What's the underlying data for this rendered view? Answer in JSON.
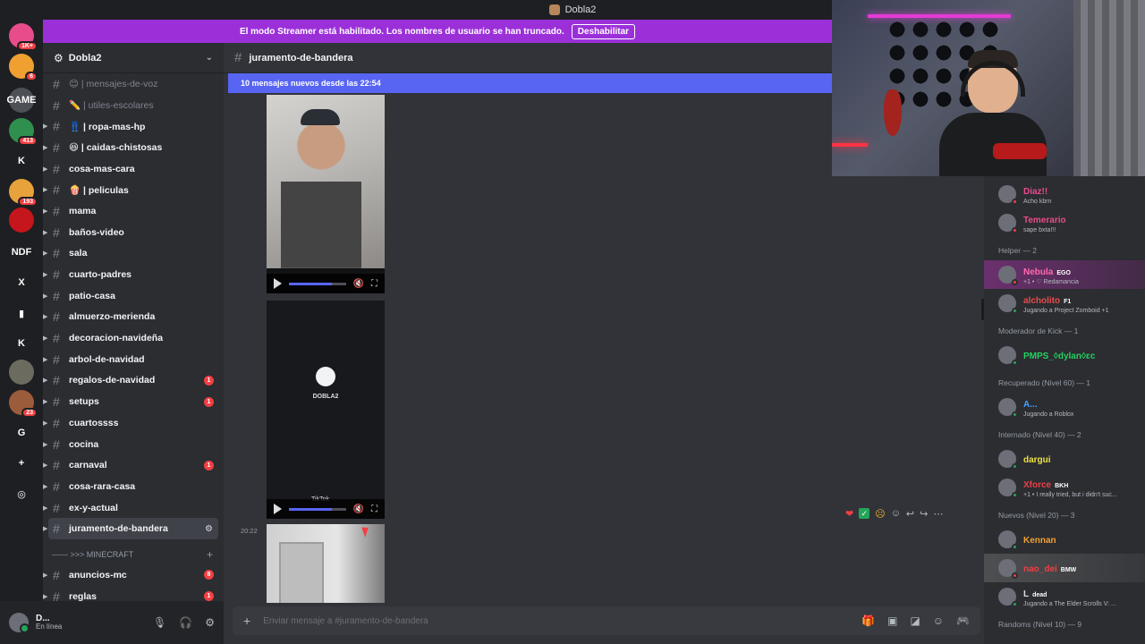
{
  "title_bar": {
    "server_name": "Dobla2"
  },
  "banner": {
    "text": "El modo Streamer está habilitado. Los nombres de usuario se han truncado.",
    "button": "Deshabilitar"
  },
  "rail": {
    "servers": [
      {
        "label": "",
        "badge": "1K+",
        "color": "#e84c8b"
      },
      {
        "label": "",
        "badge": "6",
        "color": "#f0a030"
      },
      {
        "label": "GAME",
        "badge": "",
        "color": "#4e5058"
      },
      {
        "label": "",
        "badge": "413",
        "color": "#2f8f4e"
      },
      {
        "label": "K",
        "badge": "",
        "color": "#1e1f22"
      },
      {
        "label": "",
        "badge": "193",
        "color": "#e8a23c"
      },
      {
        "label": "",
        "badge": "",
        "color": "#c4161c"
      },
      {
        "label": "NDF",
        "badge": "",
        "color": "#1e1f22"
      },
      {
        "label": "X",
        "badge": "",
        "color": "#1e1f22"
      },
      {
        "label": "▮",
        "badge": "",
        "color": "#1e1f22"
      },
      {
        "label": "K",
        "badge": "",
        "color": "#1e1f22"
      },
      {
        "label": "",
        "badge": "",
        "color": "#6b6b60"
      },
      {
        "label": "",
        "badge": "23",
        "color": "#9b5c3c"
      },
      {
        "label": "G",
        "badge": "",
        "color": "#1e1f22"
      },
      {
        "label": "+",
        "badge": "",
        "color": "#1e1f22"
      },
      {
        "label": "◎",
        "badge": "",
        "color": "#1e1f22"
      }
    ]
  },
  "sidebar": {
    "server_name": "Dobla2",
    "channels": [
      {
        "label": "😊 | mensajes-de-voz",
        "muted": true,
        "arrow": false,
        "badge": ""
      },
      {
        "label": "✏️ | utiles-escolares",
        "muted": true,
        "arrow": false,
        "badge": ""
      },
      {
        "label": "👖 | ropa-mas-hp",
        "muted": false,
        "arrow": true,
        "badge": ""
      },
      {
        "label": "😆 | caidas-chistosas",
        "muted": false,
        "arrow": true,
        "badge": ""
      },
      {
        "label": "cosa-mas-cara",
        "muted": false,
        "arrow": true,
        "badge": ""
      },
      {
        "label": "🍿 | peliculas",
        "muted": false,
        "arrow": true,
        "badge": ""
      },
      {
        "label": "mama",
        "muted": false,
        "arrow": true,
        "badge": ""
      },
      {
        "label": "baños-video",
        "muted": false,
        "arrow": true,
        "badge": ""
      },
      {
        "label": "sala",
        "muted": false,
        "arrow": true,
        "badge": ""
      },
      {
        "label": "cuarto-padres",
        "muted": false,
        "arrow": true,
        "badge": ""
      },
      {
        "label": "patio-casa",
        "muted": false,
        "arrow": true,
        "badge": ""
      },
      {
        "label": "almuerzo-merienda",
        "muted": false,
        "arrow": true,
        "badge": ""
      },
      {
        "label": "decoracion-navideña",
        "muted": false,
        "arrow": true,
        "badge": ""
      },
      {
        "label": "arbol-de-navidad",
        "muted": false,
        "arrow": true,
        "badge": ""
      },
      {
        "label": "regalos-de-navidad",
        "muted": false,
        "arrow": true,
        "badge": "1"
      },
      {
        "label": "setups",
        "muted": false,
        "arrow": true,
        "badge": "1"
      },
      {
        "label": "cuartossss",
        "muted": false,
        "arrow": true,
        "badge": ""
      },
      {
        "label": "cocina",
        "muted": false,
        "arrow": true,
        "badge": ""
      },
      {
        "label": "carnaval",
        "muted": false,
        "arrow": true,
        "badge": "1"
      },
      {
        "label": "cosa-rara-casa",
        "muted": false,
        "arrow": true,
        "badge": ""
      },
      {
        "label": "ex-y-actual",
        "muted": false,
        "arrow": true,
        "badge": ""
      }
    ],
    "active_channel": "juramento-de-bandera",
    "category": "------ >>> MINECRAFT",
    "mc_channels": [
      {
        "label": "anuncios-mc",
        "badge": "8"
      },
      {
        "label": "reglas",
        "badge": "1"
      }
    ]
  },
  "user_panel": {
    "name": "D...",
    "status": "En línea"
  },
  "chat": {
    "channel": "juramento-de-bandera",
    "new_messages": "10 mensajes nuevos desde las 22:54",
    "timestamp": "20:22",
    "video2_logo_text": "DOBLA2",
    "tiktok_label": "TikTok",
    "video1_progress": 0.75,
    "video2_progress": 0.75,
    "placeholder": "Enviar mensaje a #juramento-de-bandera"
  },
  "members": {
    "top": [
      {
        "name": "Diaz!!",
        "sub": "Acho kbrn",
        "color": "#e84c8b",
        "status": "#f23f43"
      },
      {
        "name": "Temerario",
        "sub": "sape bxta!!!",
        "color": "#e84c8b",
        "status": "#f23f43"
      }
    ],
    "groups": [
      {
        "title": "Helper — 2",
        "items": [
          {
            "name": "Nebula",
            "tag": "EGO",
            "sub": "+1 • ♡ Redamancia",
            "color": "#ff6ab0",
            "status": "#f23f43",
            "hl": "hl"
          },
          {
            "name": "alcholito",
            "tag": "F1",
            "sub": "Jugando a Project Zomboid +1",
            "color": "#e84c4c",
            "status": "#23a55a",
            "hl": ""
          }
        ]
      },
      {
        "title": "Moderador de Kick — 1",
        "items": [
          {
            "name": "PMPS_◊dylan◊ɛc",
            "tag": "",
            "sub": "",
            "color": "#23d160",
            "status": "#23a55a",
            "hl": ""
          }
        ]
      },
      {
        "title": "Recuperado (Nivel 60) — 1",
        "items": [
          {
            "name": "A...",
            "tag": "",
            "sub": "Jugando a Roblox",
            "color": "#3da5ff",
            "status": "#23a55a",
            "hl": ""
          }
        ]
      },
      {
        "title": "Internado (Nivel 40) — 2",
        "items": [
          {
            "name": "dargui",
            "tag": "",
            "sub": "",
            "color": "#f0e040",
            "status": "#23a55a",
            "hl": ""
          },
          {
            "name": "Xforce",
            "tag": "BKH",
            "sub": "+1 • I really tried, but i didn't suc...",
            "color": "#f23f43",
            "status": "#23a55a",
            "hl": ""
          }
        ]
      },
      {
        "title": "Nuevos (Nivel 20) — 3",
        "items": [
          {
            "name": "Kennan",
            "tag": "",
            "sub": "",
            "color": "#f0a030",
            "status": "#23a55a",
            "hl": ""
          },
          {
            "name": "nao_dei",
            "tag": "BMW",
            "sub": "",
            "color": "#f23f43",
            "status": "#f23f43",
            "hl": "hl2"
          },
          {
            "name": "L",
            "tag": "dead",
            "sub": "Jugando a The Elder Scrolls V: ...",
            "color": "#dbdee1",
            "status": "#23a55a",
            "hl": ""
          }
        ]
      },
      {
        "title": "Randoms (Nivel 10) — 9",
        "items": []
      }
    ]
  }
}
